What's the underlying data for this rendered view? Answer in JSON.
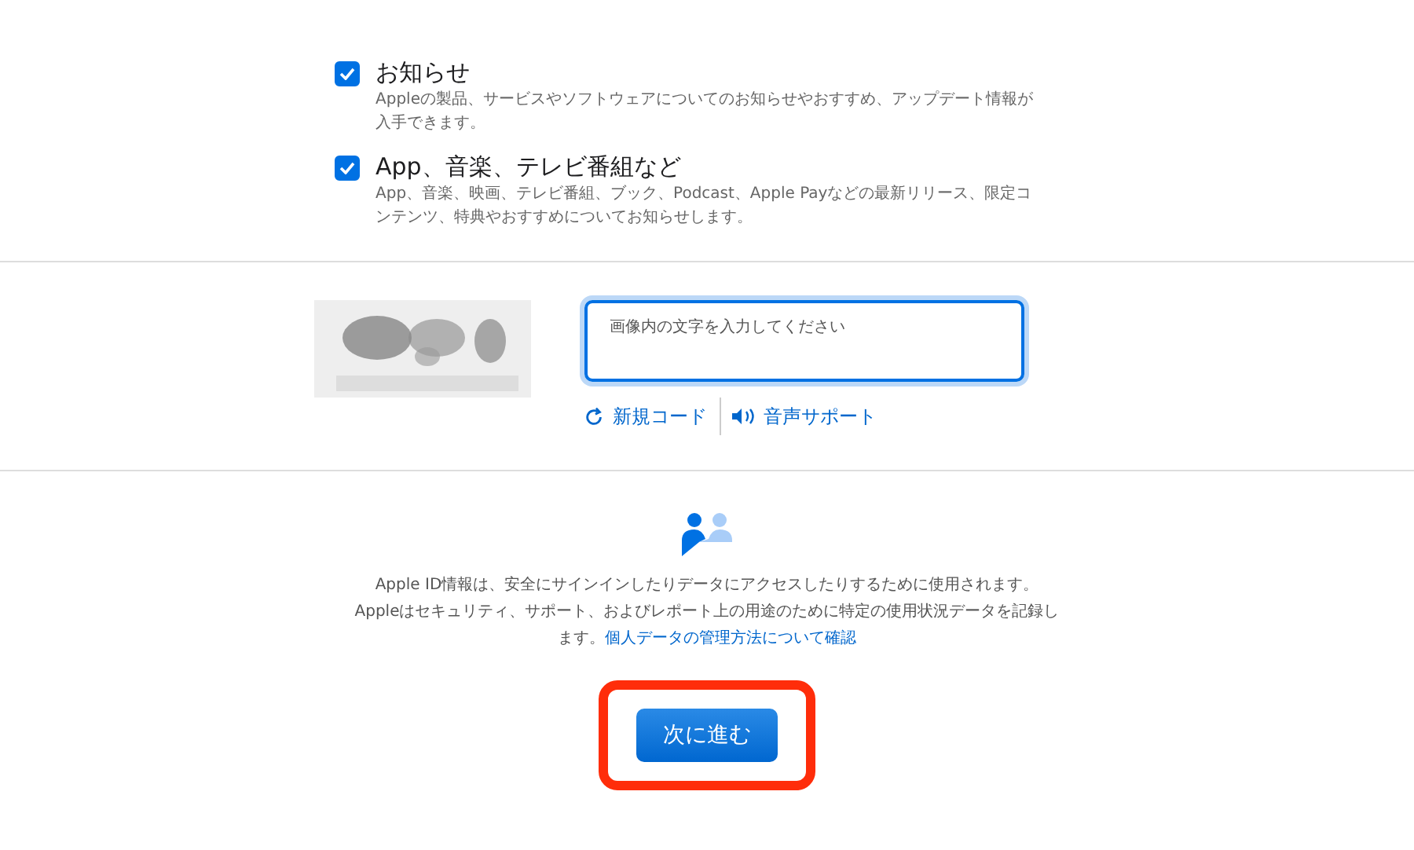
{
  "options": [
    {
      "title": "お知らせ",
      "description": "Appleの製品、サービスやソフトウェアについてのお知らせやおすすめ、アップデート情報が入手できます。",
      "checked": true
    },
    {
      "title": "App、音楽、テレビ番組など",
      "description": "App、音楽、映画、テレビ番組、ブック、Podcast、Apple Payなどの最新リリース、限定コンテンツ、特典やおすすめについてお知らせします。",
      "checked": true
    }
  ],
  "captcha": {
    "field_label": "画像内の文字を入力してください",
    "links": [
      {
        "kind": "refresh",
        "label": "新規コード"
      },
      {
        "kind": "audio",
        "label": "音声サポート"
      }
    ]
  },
  "privacy": {
    "text": "Apple ID情報は、安全にサインインしたりデータにアクセスしたりするために使用されます。Appleはセキュリティ、サポート、およびレポート上の用途のために特定の使用状況データを記録します。",
    "link": "個人データの管理方法について確認"
  },
  "continue_button": {
    "label": "次に進む",
    "highlighted": true
  }
}
